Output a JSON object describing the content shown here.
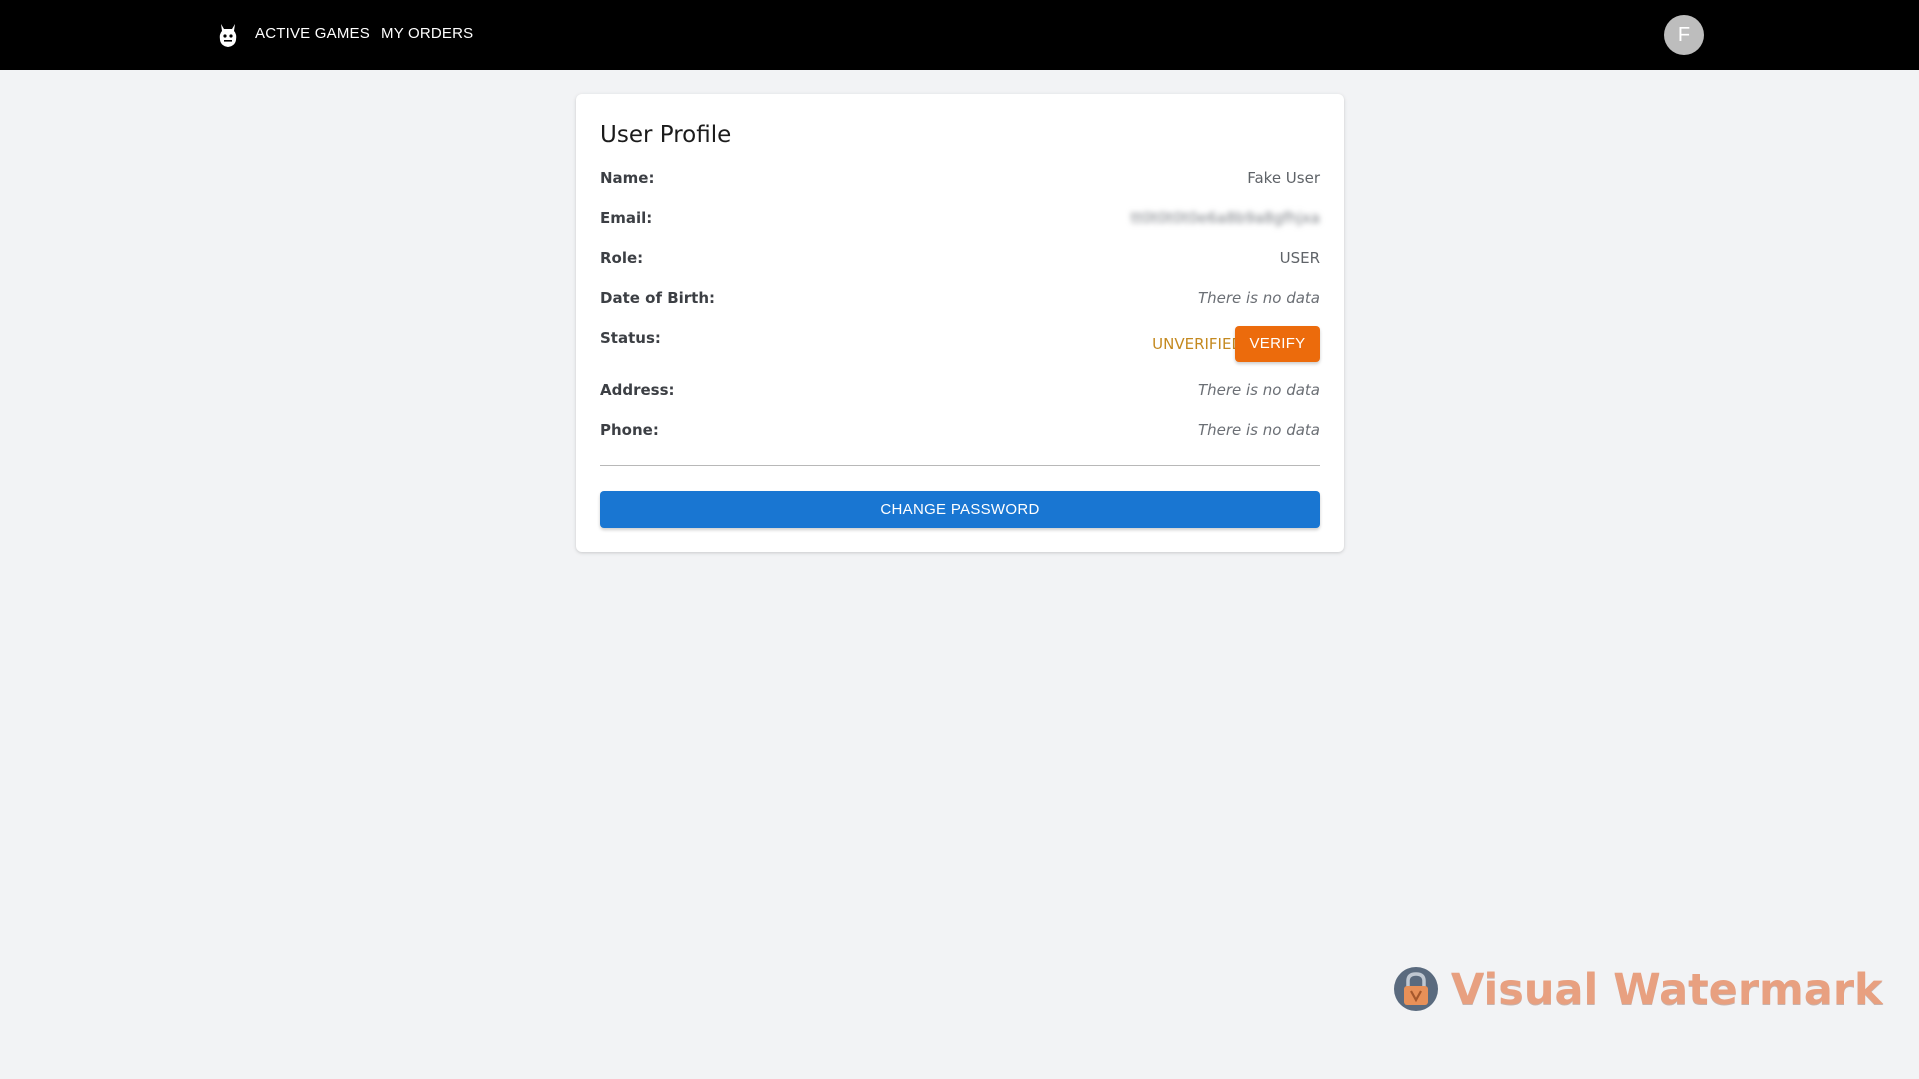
{
  "nav": {
    "active_games": "ACTIVE GAMES",
    "my_orders": "MY ORDERS",
    "avatar_initial": "F"
  },
  "profile": {
    "title": "User Profile",
    "name_label": "Name:",
    "name_value": "Fake User",
    "email_label": "Email:",
    "email_value": "tt0t0t0t0e6a8b9a8gfhjxa",
    "role_label": "Role:",
    "role_value": "USER",
    "dob_label": "Date of Birth:",
    "dob_value": "There is no data",
    "status_label": "Status:",
    "status_value": "UNVERIFIED",
    "verify_label": "VERIFY",
    "address_label": "Address:",
    "address_value": "There is no data",
    "phone_label": "Phone:",
    "phone_value": "There is no data",
    "change_password_label": "CHANGE PASSWORD"
  },
  "watermark": {
    "text": "Visual Watermark",
    "icon": "padlock-icon"
  },
  "colors": {
    "topbar": "#000000",
    "background": "#f2f3f5",
    "primary": "#1976d2",
    "warning": "#ec6b0c",
    "status_unverified": "#c4891f",
    "watermark": "#e8a080"
  }
}
